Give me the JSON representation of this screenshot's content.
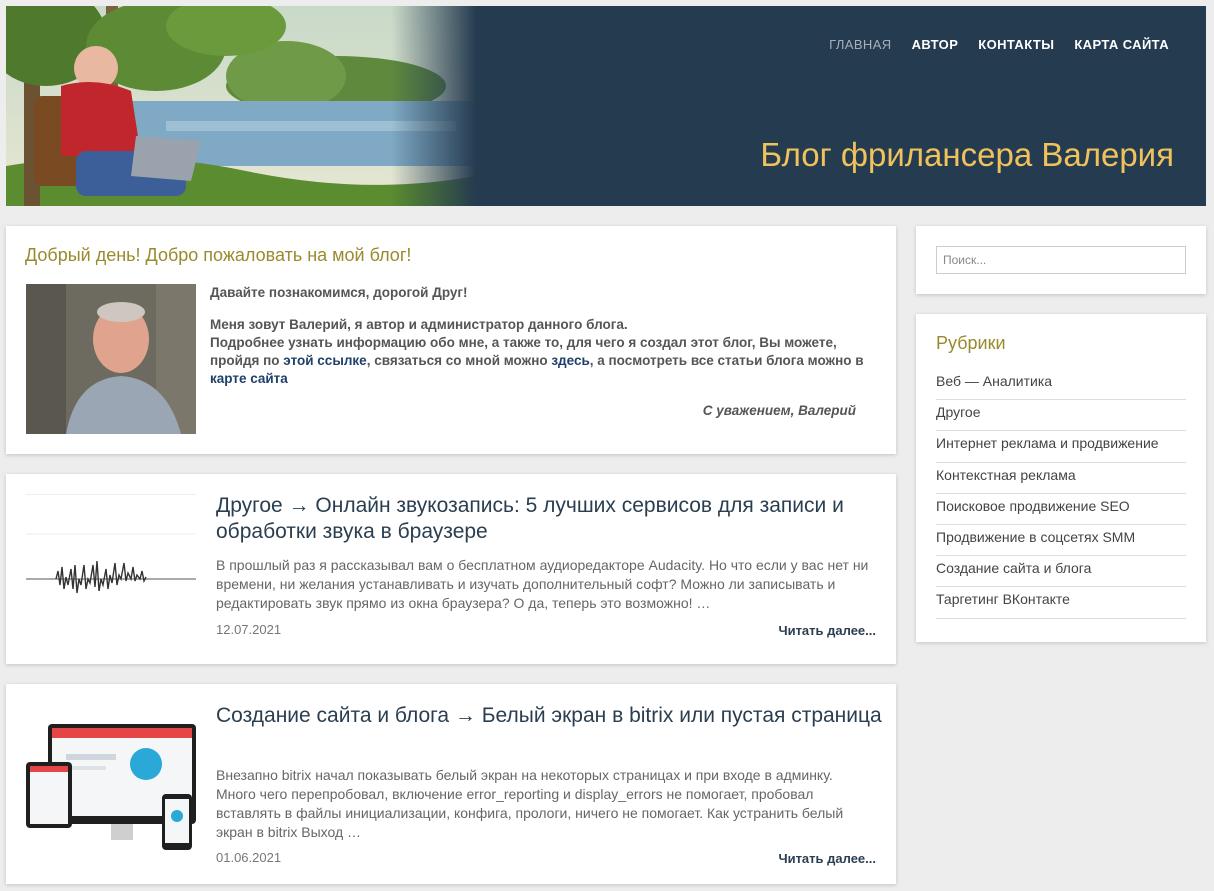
{
  "header": {
    "site_title": "Блог фрилансера Валерия",
    "nav": [
      {
        "label": "ГЛАВНАЯ",
        "active": true
      },
      {
        "label": "АВТОР",
        "active": false
      },
      {
        "label": "КОНТАКТЫ",
        "active": false
      },
      {
        "label": "КАРТА САЙТА",
        "active": false
      }
    ],
    "colors": {
      "background": "#253b50",
      "title": "#f0c25c"
    }
  },
  "welcome": {
    "title": "Добрый день! Добро пожаловать на мой блог!",
    "greeting": "Давайте познакомимся, дорогой Друг!",
    "intro": "Меня зовут Валерий, я автор и администратор данного блога.",
    "text_1": "Подробнее узнать информацию обо мне, а также то, для чего я создал этот блог, Вы можете, пройдя по ",
    "link_1": "этой ссылке",
    "text_2": ", связаться со мной можно ",
    "link_2": "здесь",
    "text_3": ", а посмотреть все статьи блога можно в ",
    "link_3": "карте сайта",
    "signature": "С уважением, Валерий"
  },
  "posts": [
    {
      "title": "Другое → Онлайн звукозапись: 5 лучших сервисов для записи и обработки звука в браузере",
      "excerpt": "В прошлый раз я рассказывал вам о бесплатном аудиоредакторе Audacity. Но что если у вас нет ни времени, ни желания устанавливать и изучать дополнительный софт? Можно ли записывать и редактировать звук прямо из окна браузера? О да, теперь это возможно! …",
      "date": "12.07.2021",
      "read_more": "Читать далее..."
    },
    {
      "title": "Создание сайта и блога → Белый экран в bitrix или пустая страница",
      "excerpt": "Внезапно bitrix начал показывать белый экран на некоторых страницах и при входе в админку. Много чего перепробовал, включение error_reporting и display_errors не помогает, пробовал вставлять в файлы инициализации, конфига, прологи, ничего не помогает. Как устранить белый экран в bitrix Выход …",
      "date": "01.06.2021",
      "read_more": "Читать далее..."
    }
  ],
  "sidebar": {
    "search_placeholder": "Поиск...",
    "rubrics_title": "Рубрики",
    "rubrics": [
      "Веб — Аналитика",
      "Другое",
      "Интернет реклама и продвижение",
      "Контекстная реклама",
      "Поисковое продвижение SEO",
      "Продвижение в соцсетях SMM",
      "Создание сайта и блога",
      "Таргетинг ВКонтакте"
    ]
  },
  "icons": {
    "header_art": "man-with-laptop-by-lake-illustration",
    "author_photo": "author-portrait-photo",
    "post1_thumb": "audio-waveform-image",
    "post2_thumb": "responsive-devices-image"
  }
}
